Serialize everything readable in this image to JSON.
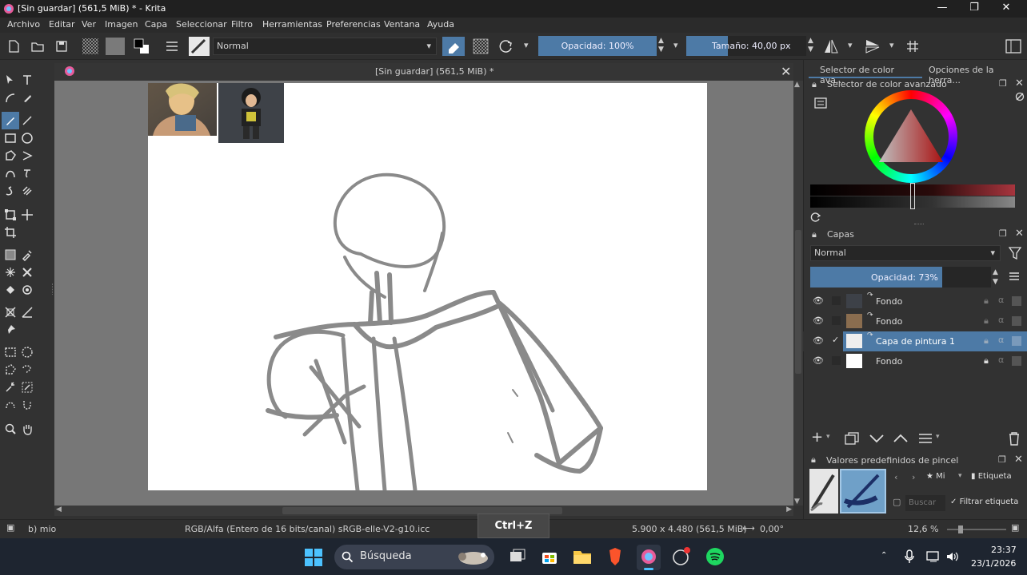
{
  "window": {
    "title": "[Sin guardar]  (561,5 MiB) * - Krita"
  },
  "menu": [
    "Archivo",
    "Editar",
    "Ver",
    "Imagen",
    "Capa",
    "Seleccionar",
    "Filtro",
    "Herramientas",
    "Preferencias",
    "Ventana",
    "Ayuda"
  ],
  "toolbar": {
    "blend_mode": "Normal",
    "opacity": "Opacidad: 100%",
    "size": "Tamaño: 40,00 px"
  },
  "document": {
    "tab_title": "[Sin guardar]  (561,5 MiB) *"
  },
  "docker_tabs": [
    "Selector de color ava...",
    "Opciones de la herra..."
  ],
  "color_selector": {
    "title": "Selector de color avanzado"
  },
  "layers": {
    "title": "Capas",
    "blend_mode": "Normal",
    "opacity": "Opacidad:  73%",
    "opacity_level": 0.73,
    "items": [
      {
        "name": "Fondo",
        "visible": true,
        "selected": false
      },
      {
        "name": "Fondo",
        "visible": true,
        "selected": false
      },
      {
        "name": "Capa de pintura 1",
        "visible": true,
        "selected": true,
        "checked": true
      },
      {
        "name": "Fondo",
        "visible": true,
        "selected": false,
        "locked": true
      }
    ]
  },
  "brush_presets": {
    "title": "Valores predefinidos de pincel",
    "tag_short": "Mi",
    "tag_label": "Etiqueta",
    "search_placeholder": "Buscar",
    "filter_label": "Filtrar etiqueta"
  },
  "status": {
    "brush": "b) mio",
    "color_space": "RGB/Alfa (Entero de 16 bits/canal)  sRGB-elle-V2-g10.icc",
    "dimensions": "5.900 x 4.480 (561,5 MiB)",
    "rotation": "0,00°",
    "zoom": "12,6 %",
    "shortcut_overlay": "Ctrl+Z"
  },
  "taskbar": {
    "search_label": "Búsqueda",
    "time": "23:37",
    "date": "23/1/2026"
  },
  "colors": {
    "accent": "#4d7aa6",
    "panel": "#323232",
    "canvas_bg": "#777777",
    "sketch": "#8a8a8a"
  }
}
